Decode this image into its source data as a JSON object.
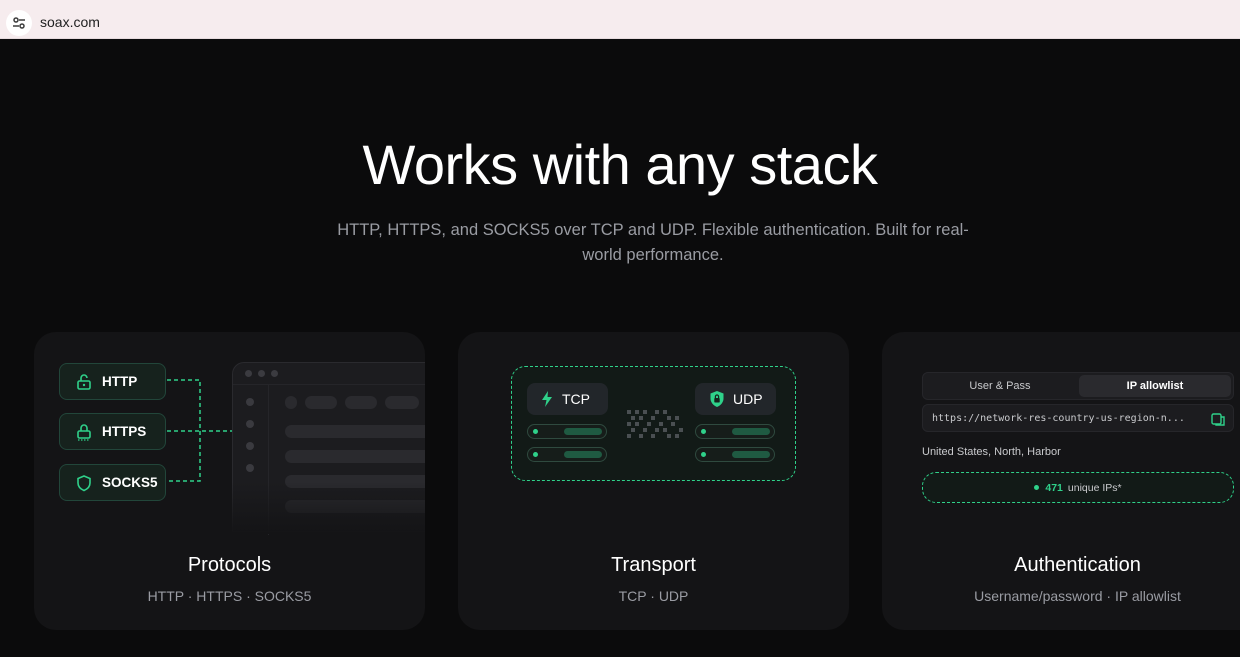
{
  "browser": {
    "url": "soax.com",
    "site_settings_icon": "tune-icon"
  },
  "hero": {
    "title": "Works with any stack",
    "subtitle": "HTTP, HTTPS, and SOCKS5 over TCP and UDP. Flexible authentication. Built for real-world performance."
  },
  "cards": [
    {
      "title": "Protocols",
      "subtitle": "HTTP · HTTPS · SOCKS5",
      "pills": [
        {
          "label": "HTTP",
          "icon": "lock-open-icon"
        },
        {
          "label": "HTTPS",
          "icon": "lock-icon"
        },
        {
          "label": "SOCKS5",
          "icon": "shield-icon"
        }
      ]
    },
    {
      "title": "Transport",
      "subtitle": "TCP · UDP",
      "chips": [
        {
          "label": "TCP",
          "icon": "bolt-icon"
        },
        {
          "label": "UDP",
          "icon": "shield-lock-icon"
        }
      ]
    },
    {
      "title": "Authentication",
      "subtitle": "Username/password · IP allowlist",
      "tabs": [
        "User & Pass",
        "IP allowlist"
      ],
      "active_tab": "IP allowlist",
      "endpoint": "https://network-res-country-us-region-n...",
      "location": "United States, North, Harbor",
      "ips_count": "471",
      "ips_label": "unique IPs*"
    }
  ],
  "colors": {
    "accent": "#2fd18a",
    "background": "#0b0b0c",
    "card": "#141416"
  }
}
